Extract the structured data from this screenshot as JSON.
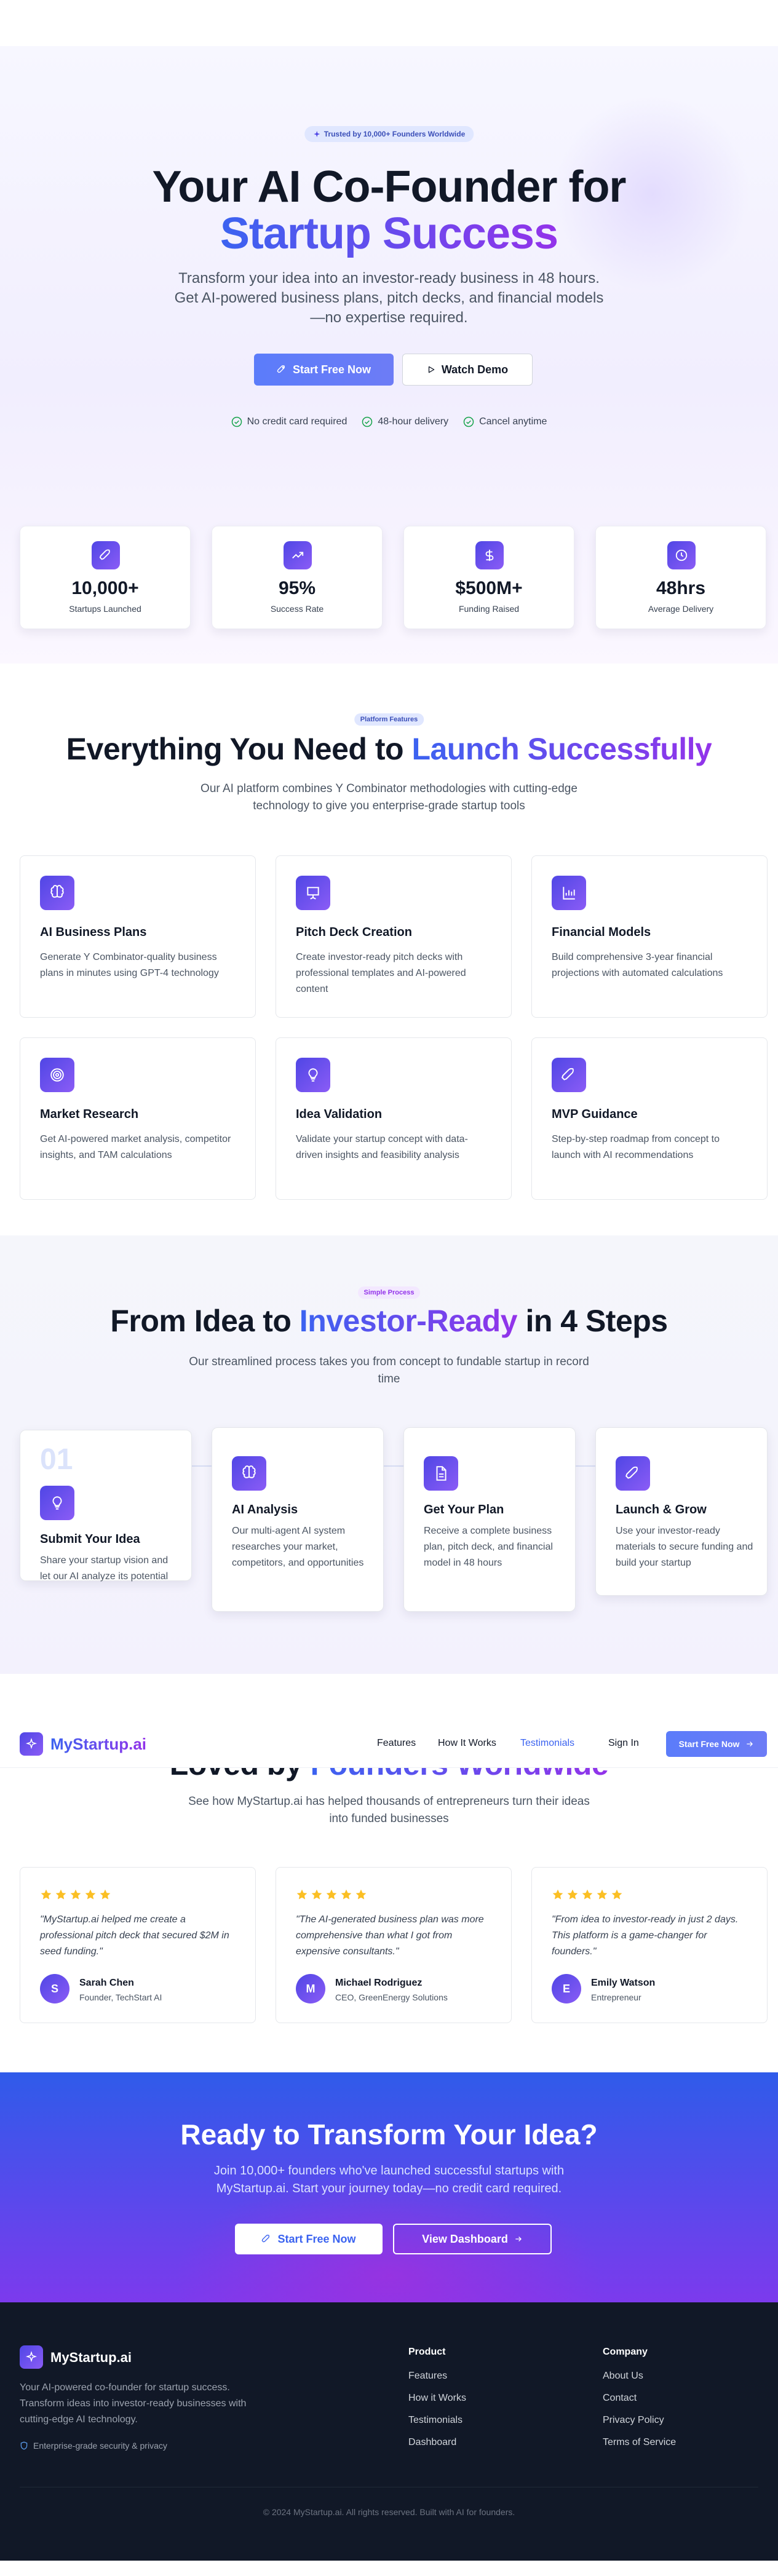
{
  "hero": {
    "badge": "Trusted by 10,000+ Founders Worldwide",
    "title_line1": "Your AI Co-Founder for",
    "title_line2": "Startup Success",
    "lead_line1": "Transform your idea into an investor-ready business in 48 hours.",
    "lead_line2": "Get AI-powered business plans, pitch decks, and financial models",
    "lead_line3": "—no expertise required.",
    "primary_button": "Start Free Now",
    "secondary_button": "Watch Demo",
    "checks": [
      "No credit card required",
      "48-hour delivery",
      "Cancel anytime"
    ],
    "stats": [
      {
        "value": "10,000+",
        "label": "Startups Launched",
        "icon": "rocket-icon"
      },
      {
        "value": "95%",
        "label": "Success Rate",
        "icon": "trending-up-icon"
      },
      {
        "value": "$500M+",
        "label": "Funding Raised",
        "icon": "dollar-icon"
      },
      {
        "value": "48hrs",
        "label": "Average Delivery",
        "icon": "clock-icon"
      }
    ]
  },
  "features": {
    "pill": "Platform Features",
    "title_plain": "Everything You Need to",
    "title_grad": "Launch Successfully",
    "lead_line1": "Our AI platform combines Y Combinator methodologies with cutting-edge",
    "lead_line2": "technology to give you enterprise-grade startup tools",
    "items": [
      {
        "title": "AI Business Plans",
        "desc": "Generate Y Combinator-quality business plans in minutes using GPT-4 technology",
        "icon": "brain-icon"
      },
      {
        "title": "Pitch Deck Creation",
        "desc": "Create investor-ready pitch decks with professional templates and AI-powered content",
        "icon": "presentation-icon"
      },
      {
        "title": "Financial Models",
        "desc": "Build comprehensive 3-year financial projections with automated calculations",
        "icon": "bar-chart-icon"
      },
      {
        "title": "Market Research",
        "desc": "Get AI-powered market analysis, competitor insights, and TAM calculations",
        "icon": "target-icon"
      },
      {
        "title": "Idea Validation",
        "desc": "Validate your startup concept with data-driven insights and feasibility analysis",
        "icon": "lightbulb-icon"
      },
      {
        "title": "MVP Guidance",
        "desc": "Step-by-step roadmap from concept to launch with AI recommendations",
        "icon": "rocket-icon"
      }
    ]
  },
  "process": {
    "pill": "Simple Process",
    "title_plain1": "From Idea to",
    "title_grad": "Investor-Ready",
    "title_plain2": "in 4 Steps",
    "lead_line1": "Our streamlined process takes you from concept to fundable startup in record",
    "lead_line2": "time",
    "steps": [
      {
        "number": "01",
        "title": "Submit Your Idea",
        "desc": "Share your startup vision and let our AI analyze its potential",
        "icon": "lightbulb-icon"
      },
      {
        "title": "AI Analysis",
        "desc": "Our multi-agent AI system researches your market, competitors, and opportunities",
        "icon": "brain-icon"
      },
      {
        "title": "Get Your Plan",
        "desc": "Receive a complete business plan, pitch deck, and financial model in 48 hours",
        "icon": "document-icon"
      },
      {
        "title": "Launch & Grow",
        "desc": "Use your investor-ready materials to secure funding and build your startup",
        "icon": "rocket-icon"
      }
    ]
  },
  "nav": {
    "brand": "MyStartup.ai",
    "links": [
      "Features",
      "How It Works",
      "Testimonials"
    ],
    "sign_in": "Sign In",
    "cta": "Start Free Now"
  },
  "testimonials": {
    "title_plain": "Loved by",
    "title_grad": "Founders Worldwide",
    "lead_line1": "See how MyStartup.ai has helped thousands of entrepreneurs turn their ideas",
    "lead_line2": "into funded businesses",
    "items": [
      {
        "quote": "\"MyStartup.ai helped me create a professional pitch deck that secured $2M in seed funding.\"",
        "initial": "S",
        "name": "Sarah Chen",
        "role": "Founder, TechStart AI"
      },
      {
        "quote": "\"The AI-generated business plan was more comprehensive than what I got from expensive consultants.\"",
        "initial": "M",
        "name": "Michael Rodriguez",
        "role": "CEO, GreenEnergy Solutions"
      },
      {
        "quote": "\"From idea to investor-ready in just 2 days. This platform is a game-changer for founders.\"",
        "initial": "E",
        "name": "Emily Watson",
        "role": "Entrepreneur"
      }
    ]
  },
  "cta": {
    "title": "Ready to Transform Your Idea?",
    "lead_line1": "Join 10,000+ founders who've launched successful startups with",
    "lead_line2": "MyStartup.ai. Start your journey today—no credit card required.",
    "primary_button": "Start Free Now",
    "secondary_button": "View Dashboard"
  },
  "footer": {
    "brand": "MyStartup.ai",
    "desc_line1": "Your AI-powered co-founder for startup success.",
    "desc_line2": "Transform ideas into investor-ready businesses with",
    "desc_line3": "cutting-edge AI technology.",
    "security": "Enterprise-grade security & privacy",
    "product_heading": "Product",
    "product_links": [
      "Features",
      "How it Works",
      "Testimonials",
      "Dashboard"
    ],
    "company_heading": "Company",
    "company_links": [
      "About Us",
      "Contact",
      "Privacy Policy",
      "Terms of Service"
    ],
    "copyright": "© 2024 MyStartup.ai. All rights reserved. Built with AI for founders."
  },
  "colors": {
    "brand_blue": "#3b63f0",
    "brand_purple": "#9333ea",
    "footer_bg": "#111827",
    "star": "#fbbf24",
    "check": "#16a34a"
  }
}
